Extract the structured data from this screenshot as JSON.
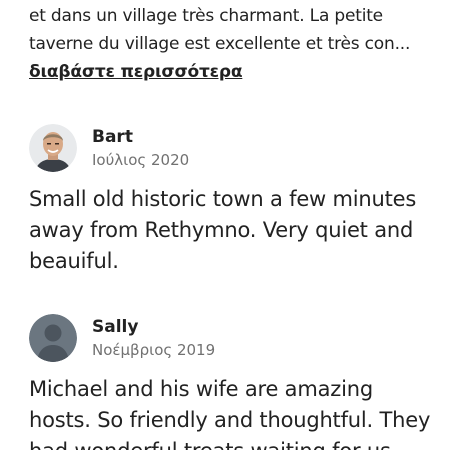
{
  "previous_review": {
    "text": "et dans un village très charmant. La petite taverne du village est excellente et très con...",
    "read_more_label": "διαβάστε περισσότερα"
  },
  "reviews": [
    {
      "name": "Bart",
      "date": "Ιούλιος 2020",
      "avatar": "photo",
      "text": "Small old historic town a few minutes away from Rethymno. Very quiet and beauiful."
    },
    {
      "name": "Sally",
      "date": "Νοέμβριος 2019",
      "avatar": "default-user-icon",
      "text": "Michael and his wife are amazing hosts. So friendly and thoughtful. They had wonderful treats waiting for us"
    }
  ],
  "colors": {
    "text": "#222222",
    "secondary_text": "#717171",
    "avatar_placeholder": "#6b7680"
  }
}
